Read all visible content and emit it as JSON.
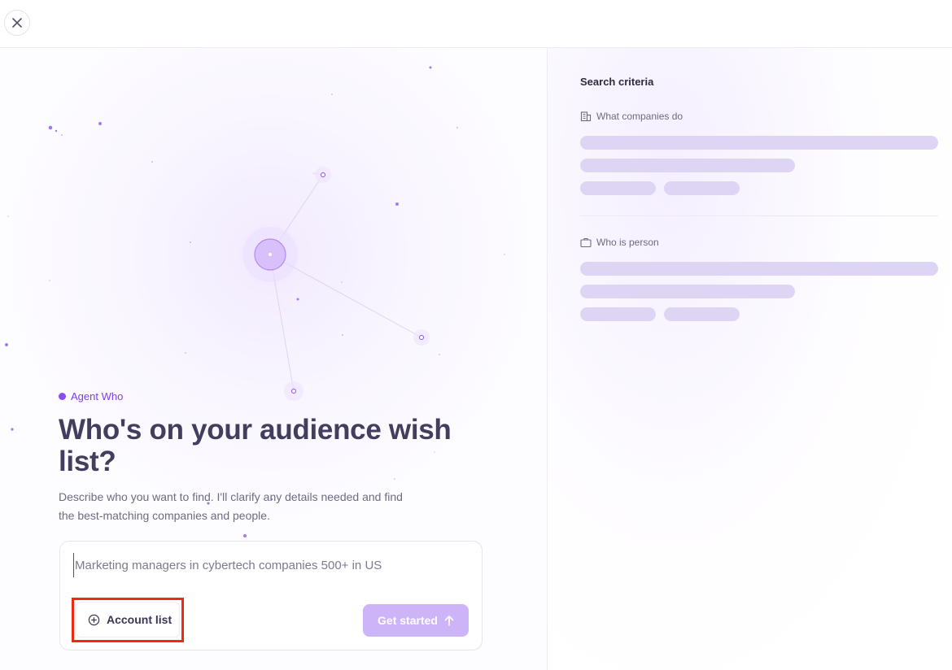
{
  "header": {
    "close_icon": "close-icon"
  },
  "agent": {
    "badge_label": "Agent Who",
    "accent": "#8a4ef0"
  },
  "hero": {
    "headline": "Who's on your audience wish list?",
    "description": "Describe who you want to find. I'll clarify any details needed and find the best-matching companies and people."
  },
  "prompt": {
    "placeholder": "Marketing managers in cybertech companies 500+ in US",
    "account_list_label": "Account list",
    "account_list_icon": "plus-circle-icon",
    "get_started_label": "Get started",
    "get_started_icon": "arrow-up-icon"
  },
  "criteria": {
    "title": "Search criteria",
    "sections": [
      {
        "label": "What companies do",
        "icon": "building-icon"
      },
      {
        "label": "Who is person",
        "icon": "briefcase-icon"
      }
    ]
  },
  "colors": {
    "primary_disabled": "#cdb3f8",
    "skeleton": "#ddd5f3",
    "highlight_border": "#ef2a12"
  }
}
